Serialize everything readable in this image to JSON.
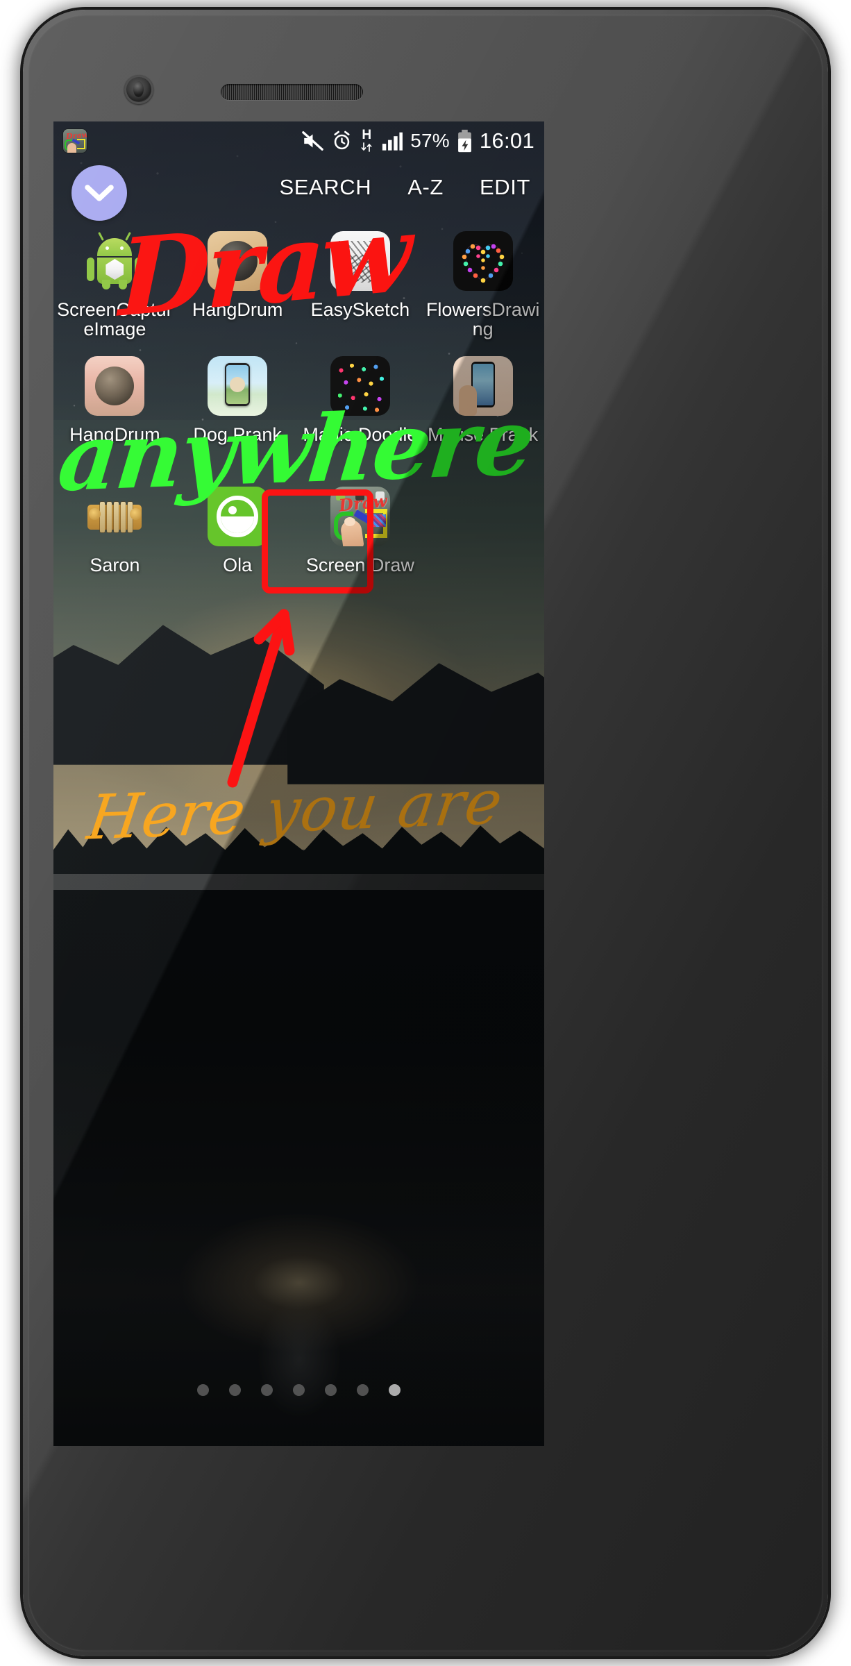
{
  "status_bar": {
    "notification_icon": "screen-draw-app-icon",
    "icons": [
      "mute-icon",
      "alarm-icon",
      "hspa-data-icon",
      "signal-bars-icon",
      "battery-charging-icon"
    ],
    "data_network_label": "H",
    "battery_percent": "57%",
    "clock": "16:01"
  },
  "drawer": {
    "collapse_icon": "chevron-down-icon",
    "actions": [
      {
        "label": "SEARCH",
        "name": "search-action"
      },
      {
        "label": "A-Z",
        "name": "sort-az-action"
      },
      {
        "label": "EDIT",
        "name": "edit-action"
      }
    ]
  },
  "app_grid": {
    "rows": [
      [
        {
          "label": "ScreenCaptureImage",
          "icon": "android-robot-icon"
        },
        {
          "label": "HangDrum",
          "icon": "hang-drum-icon"
        },
        {
          "label": "EasySketch",
          "icon": "pencil-sketch-icon"
        },
        {
          "label": "FlowersDrawing",
          "icon": "flower-heart-icon"
        }
      ],
      [
        {
          "label": "HangDrum",
          "icon": "hang-drum-photo-icon"
        },
        {
          "label": "Dog Prank",
          "icon": "dog-phone-icon"
        },
        {
          "label": "Magic Doodle",
          "icon": "magic-dots-icon"
        },
        {
          "label": "Mouse Prank",
          "icon": "mouse-phone-icon"
        }
      ],
      [
        {
          "label": "Saron",
          "icon": "saron-xylophone-icon"
        },
        {
          "label": "Ola",
          "icon": "ola-smiley-icon"
        },
        {
          "label": "Screen Draw",
          "icon": "screen-draw-icon"
        },
        {
          "label": "",
          "icon": ""
        }
      ]
    ]
  },
  "page_indicator": {
    "total": 7,
    "active_index": 6
  },
  "annotations": {
    "draw": "Draw",
    "anywhere": "anywhere",
    "here_you_are": "Here you are",
    "arrow": "red-arrow-pointing-up",
    "highlight_box": "red-rounded-rectangle-around-screen-draw"
  },
  "colors": {
    "draw_red": "#fb0a07",
    "anywhere_green": "#2cfb2c",
    "here_orange": "#f7a318",
    "highlight_red": "#fc0a0a",
    "collapse_button": "#a7a9f0",
    "ola_green": "#5fc322",
    "status_text": "#ffffff"
  },
  "device": {
    "camera": "front-camera",
    "speaker": "earpiece-speaker",
    "sensor": "proximity-sensor"
  }
}
